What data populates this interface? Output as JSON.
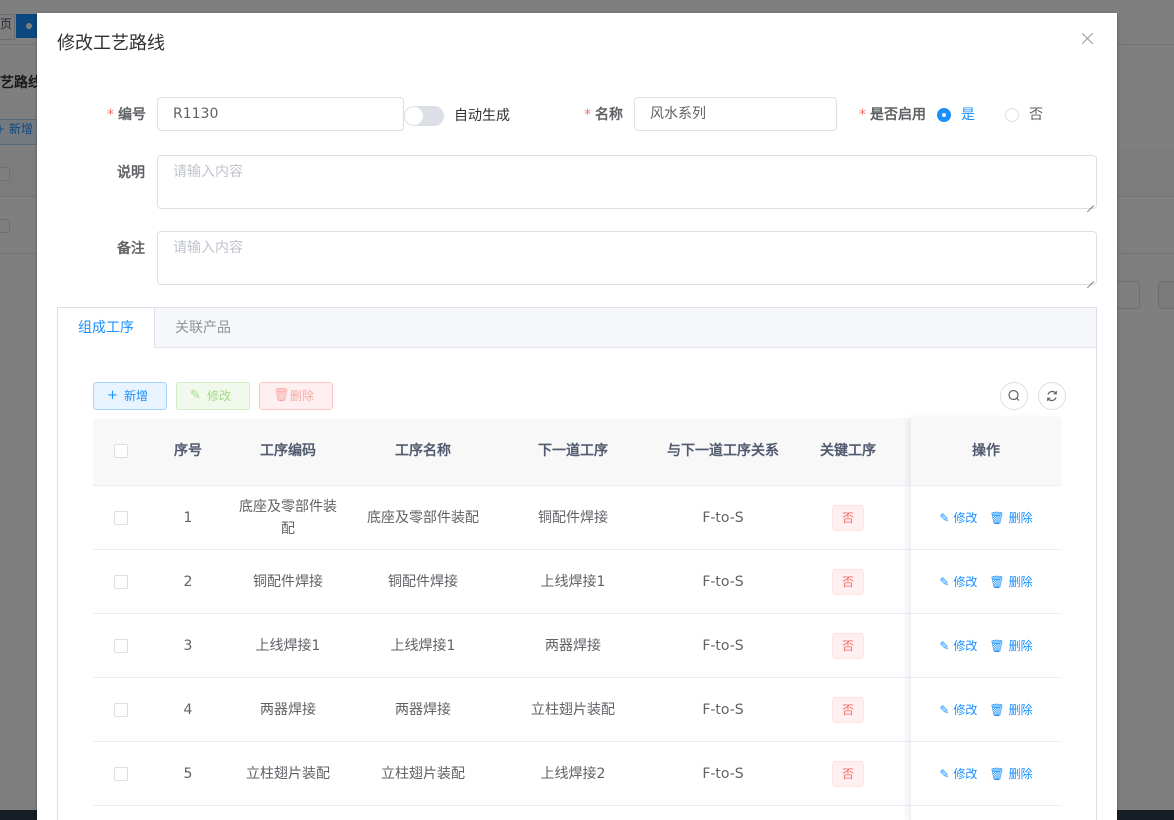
{
  "background": {
    "tab_left_label": "页",
    "page_title": "艺路线",
    "add_label": "+ 新增"
  },
  "dialog": {
    "title": "修改工艺路线",
    "close_icon": "close-icon"
  },
  "form": {
    "code_label": "编号",
    "code_value": "R1130",
    "auto_gen_label": "自动生成",
    "auto_gen_on": false,
    "name_label": "名称",
    "name_value": "风水系列",
    "enabled_label": "是否启用",
    "enabled_yes": "是",
    "enabled_no": "否",
    "enabled_value": "是",
    "desc_label": "说明",
    "desc_placeholder": "请输入内容",
    "remark_label": "备注",
    "remark_placeholder": "请输入内容"
  },
  "tabs": [
    {
      "label": "组成工序",
      "active": true
    },
    {
      "label": "关联产品",
      "active": false
    }
  ],
  "toolbar": {
    "add_label": "新增",
    "edit_label": "修改",
    "delete_label": "删除",
    "search_icon": "search-icon",
    "refresh_icon": "refresh-icon"
  },
  "table": {
    "columns": [
      "序号",
      "工序编码",
      "工序名称",
      "下一道工序",
      "与下一道工序关系",
      "关键工序",
      "操作"
    ],
    "rows": [
      {
        "index": "1",
        "code": "底座及零部件装配",
        "name": "底座及零部件装配",
        "next": "铜配件焊接",
        "relation": "F-to-S",
        "key": "否"
      },
      {
        "index": "2",
        "code": "铜配件焊接",
        "name": "铜配件焊接",
        "next": "上线焊接1",
        "relation": "F-to-S",
        "key": "否"
      },
      {
        "index": "3",
        "code": "上线焊接1",
        "name": "上线焊接1",
        "next": "两器焊接",
        "relation": "F-to-S",
        "key": "否"
      },
      {
        "index": "4",
        "code": "两器焊接",
        "name": "两器焊接",
        "next": "立柱翅片装配",
        "relation": "F-to-S",
        "key": "否"
      },
      {
        "index": "5",
        "code": "立柱翅片装配",
        "name": "立柱翅片装配",
        "next": "上线焊接2",
        "relation": "F-to-S",
        "key": "否"
      }
    ],
    "row_edit_label": "修改",
    "row_delete_label": "删除"
  },
  "colors": {
    "primary": "#1890ff",
    "danger": "#f56c6c",
    "success": "#67c23a"
  }
}
